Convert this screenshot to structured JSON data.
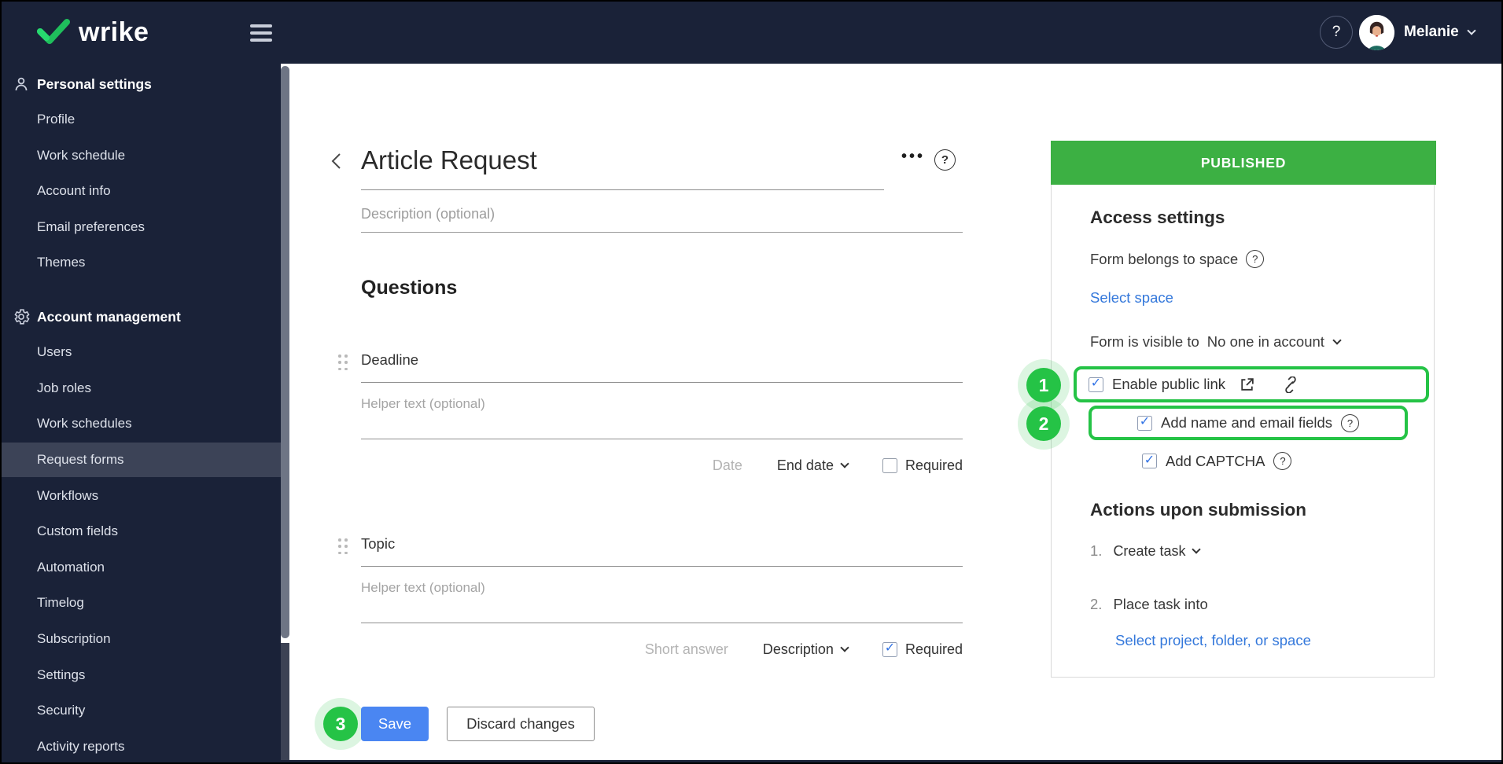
{
  "topbar": {
    "logo_text": "wrike",
    "help_label": "?",
    "user_name": "Melanie"
  },
  "sidebar": {
    "sections": [
      {
        "header": "Personal settings",
        "icon": "person-icon",
        "items": [
          "Profile",
          "Work schedule",
          "Account info",
          "Email preferences",
          "Themes"
        ]
      },
      {
        "header": "Account management",
        "icon": "gear-icon",
        "items": [
          "Users",
          "Job roles",
          "Work schedules",
          "Request forms",
          "Workflows",
          "Custom fields",
          "Automation",
          "Timelog",
          "Subscription",
          "Settings",
          "Security",
          "Activity reports"
        ]
      }
    ],
    "selected_item": "Request forms"
  },
  "form_editor": {
    "title": "Article Request",
    "description_placeholder": "Description (optional)",
    "questions_heading": "Questions",
    "questions": [
      {
        "label": "Deadline",
        "helper_placeholder": "Helper text (optional)",
        "type_hint": "Date",
        "type_value": "End date",
        "required_label": "Required",
        "required_checked": false
      },
      {
        "label": "Topic",
        "helper_placeholder": "Helper text (optional)",
        "type_hint": "Short answer",
        "type_value": "Description",
        "required_label": "Required",
        "required_checked": true
      }
    ],
    "footer": {
      "save_label": "Save",
      "discard_label": "Discard changes"
    }
  },
  "publish_panel": {
    "status": "PUBLISHED",
    "access_heading": "Access settings",
    "form_belongs_label": "Form belongs to space",
    "select_space_link": "Select space",
    "visibility_label": "Form is visible to",
    "visibility_value": "No one in account",
    "options": [
      {
        "label": "Enable public link",
        "checked": true
      },
      {
        "label": "Add name and email fields",
        "checked": true
      },
      {
        "label": "Add CAPTCHA",
        "checked": true
      }
    ],
    "actions_heading": "Actions upon submission",
    "action1_num": "1.",
    "action1_label": "Create task",
    "action2_num": "2.",
    "action2_label": "Place task into",
    "action2_link": "Select project, folder, or space"
  },
  "annotations": {
    "badge1": "1",
    "badge2": "2",
    "badge3": "3"
  },
  "colors": {
    "sidebar_navy": "#1A2238",
    "brand_green": "#24CE6B",
    "published_green": "#3CB043",
    "annotation_green": "#25C346",
    "save_blue": "#4A86F2",
    "link_blue": "#3478DB",
    "checkbox_blue": "#3173E6"
  }
}
